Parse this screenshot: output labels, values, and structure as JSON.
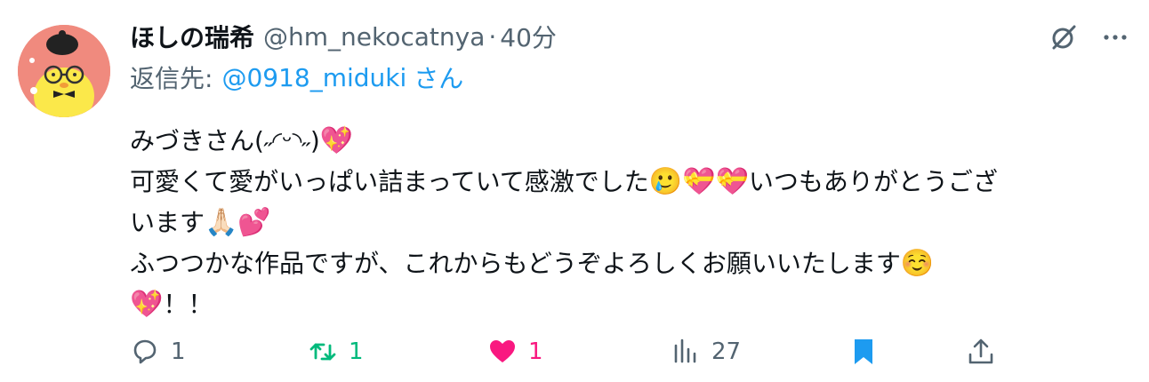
{
  "tweet": {
    "author_name": "ほしの瑞希",
    "handle": "@hm_nekocatnya",
    "separator": "·",
    "time": "40分",
    "reply_prefix": "返信先:",
    "reply_to": "@0918_miduki",
    "reply_suffix": "さん",
    "lines": [
      {
        "text": "みづきさん(˶◜ᵕ◝˶)",
        "emoji": "💖"
      },
      {
        "text": "可愛くて愛がいっぱい詰まっていて感激でした",
        "emoji": "🥲💝💝",
        "tail": "いつもありがとうござ"
      },
      {
        "text": "います",
        "emoji": "🙏🏻💕"
      },
      {
        "text": "ふつつかな作品ですが、これからもどうぞよろしくお願いいたします",
        "emoji": "☺️"
      },
      {
        "text": "",
        "emoji": "💖",
        "tail": "！！"
      }
    ]
  },
  "actions": {
    "reply_count": "1",
    "retweet_count": "1",
    "like_count": "1",
    "view_count": "27"
  },
  "colors": {
    "text": "#0f1419",
    "secondary": "#536471",
    "link": "#1d9bf0",
    "retweet": "#00ba7c",
    "like": "#f91880",
    "bookmark": "#1d9bf0",
    "avatar_bg": "#f08a7e"
  },
  "icons": [
    "grok-icon",
    "more-icon",
    "reply-icon",
    "retweet-icon",
    "heart-icon",
    "views-icon",
    "bookmark-icon",
    "share-icon"
  ]
}
